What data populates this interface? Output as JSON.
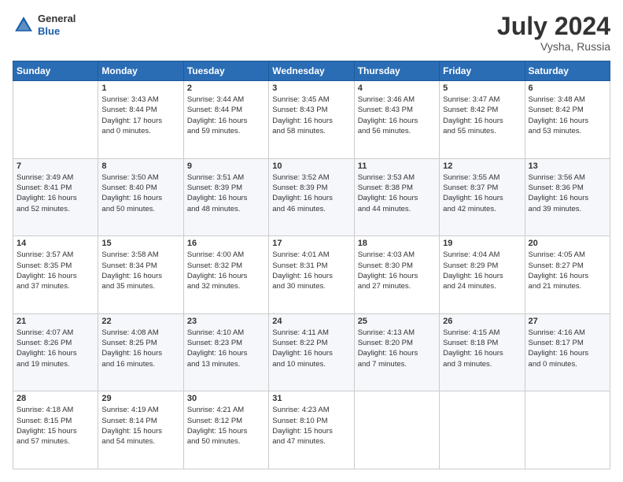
{
  "header": {
    "logo": {
      "line1": "General",
      "line2": "Blue"
    },
    "title": "July 2024",
    "location": "Vysha, Russia"
  },
  "calendar": {
    "days_of_week": [
      "Sunday",
      "Monday",
      "Tuesday",
      "Wednesday",
      "Thursday",
      "Friday",
      "Saturday"
    ],
    "weeks": [
      [
        {
          "day": "",
          "info": ""
        },
        {
          "day": "1",
          "info": "Sunrise: 3:43 AM\nSunset: 8:44 PM\nDaylight: 17 hours\nand 0 minutes."
        },
        {
          "day": "2",
          "info": "Sunrise: 3:44 AM\nSunset: 8:44 PM\nDaylight: 16 hours\nand 59 minutes."
        },
        {
          "day": "3",
          "info": "Sunrise: 3:45 AM\nSunset: 8:43 PM\nDaylight: 16 hours\nand 58 minutes."
        },
        {
          "day": "4",
          "info": "Sunrise: 3:46 AM\nSunset: 8:43 PM\nDaylight: 16 hours\nand 56 minutes."
        },
        {
          "day": "5",
          "info": "Sunrise: 3:47 AM\nSunset: 8:42 PM\nDaylight: 16 hours\nand 55 minutes."
        },
        {
          "day": "6",
          "info": "Sunrise: 3:48 AM\nSunset: 8:42 PM\nDaylight: 16 hours\nand 53 minutes."
        }
      ],
      [
        {
          "day": "7",
          "info": "Sunrise: 3:49 AM\nSunset: 8:41 PM\nDaylight: 16 hours\nand 52 minutes."
        },
        {
          "day": "8",
          "info": "Sunrise: 3:50 AM\nSunset: 8:40 PM\nDaylight: 16 hours\nand 50 minutes."
        },
        {
          "day": "9",
          "info": "Sunrise: 3:51 AM\nSunset: 8:39 PM\nDaylight: 16 hours\nand 48 minutes."
        },
        {
          "day": "10",
          "info": "Sunrise: 3:52 AM\nSunset: 8:39 PM\nDaylight: 16 hours\nand 46 minutes."
        },
        {
          "day": "11",
          "info": "Sunrise: 3:53 AM\nSunset: 8:38 PM\nDaylight: 16 hours\nand 44 minutes."
        },
        {
          "day": "12",
          "info": "Sunrise: 3:55 AM\nSunset: 8:37 PM\nDaylight: 16 hours\nand 42 minutes."
        },
        {
          "day": "13",
          "info": "Sunrise: 3:56 AM\nSunset: 8:36 PM\nDaylight: 16 hours\nand 39 minutes."
        }
      ],
      [
        {
          "day": "14",
          "info": "Sunrise: 3:57 AM\nSunset: 8:35 PM\nDaylight: 16 hours\nand 37 minutes."
        },
        {
          "day": "15",
          "info": "Sunrise: 3:58 AM\nSunset: 8:34 PM\nDaylight: 16 hours\nand 35 minutes."
        },
        {
          "day": "16",
          "info": "Sunrise: 4:00 AM\nSunset: 8:32 PM\nDaylight: 16 hours\nand 32 minutes."
        },
        {
          "day": "17",
          "info": "Sunrise: 4:01 AM\nSunset: 8:31 PM\nDaylight: 16 hours\nand 30 minutes."
        },
        {
          "day": "18",
          "info": "Sunrise: 4:03 AM\nSunset: 8:30 PM\nDaylight: 16 hours\nand 27 minutes."
        },
        {
          "day": "19",
          "info": "Sunrise: 4:04 AM\nSunset: 8:29 PM\nDaylight: 16 hours\nand 24 minutes."
        },
        {
          "day": "20",
          "info": "Sunrise: 4:05 AM\nSunset: 8:27 PM\nDaylight: 16 hours\nand 21 minutes."
        }
      ],
      [
        {
          "day": "21",
          "info": "Sunrise: 4:07 AM\nSunset: 8:26 PM\nDaylight: 16 hours\nand 19 minutes."
        },
        {
          "day": "22",
          "info": "Sunrise: 4:08 AM\nSunset: 8:25 PM\nDaylight: 16 hours\nand 16 minutes."
        },
        {
          "day": "23",
          "info": "Sunrise: 4:10 AM\nSunset: 8:23 PM\nDaylight: 16 hours\nand 13 minutes."
        },
        {
          "day": "24",
          "info": "Sunrise: 4:11 AM\nSunset: 8:22 PM\nDaylight: 16 hours\nand 10 minutes."
        },
        {
          "day": "25",
          "info": "Sunrise: 4:13 AM\nSunset: 8:20 PM\nDaylight: 16 hours\nand 7 minutes."
        },
        {
          "day": "26",
          "info": "Sunrise: 4:15 AM\nSunset: 8:18 PM\nDaylight: 16 hours\nand 3 minutes."
        },
        {
          "day": "27",
          "info": "Sunrise: 4:16 AM\nSunset: 8:17 PM\nDaylight: 16 hours\nand 0 minutes."
        }
      ],
      [
        {
          "day": "28",
          "info": "Sunrise: 4:18 AM\nSunset: 8:15 PM\nDaylight: 15 hours\nand 57 minutes."
        },
        {
          "day": "29",
          "info": "Sunrise: 4:19 AM\nSunset: 8:14 PM\nDaylight: 15 hours\nand 54 minutes."
        },
        {
          "day": "30",
          "info": "Sunrise: 4:21 AM\nSunset: 8:12 PM\nDaylight: 15 hours\nand 50 minutes."
        },
        {
          "day": "31",
          "info": "Sunrise: 4:23 AM\nSunset: 8:10 PM\nDaylight: 15 hours\nand 47 minutes."
        },
        {
          "day": "",
          "info": ""
        },
        {
          "day": "",
          "info": ""
        },
        {
          "day": "",
          "info": ""
        }
      ]
    ]
  }
}
